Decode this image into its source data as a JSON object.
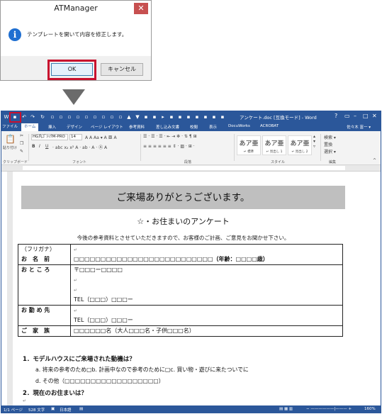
{
  "dialog": {
    "title": "ATManager",
    "close": "✕",
    "message": "テンプレートを開いて内容を修正します。",
    "ok": "OK",
    "cancel": "キャンセル"
  },
  "word": {
    "title": "アンケート.doc [互換モード] - Word",
    "tabs": [
      "ファイル",
      "ホーム",
      "挿入",
      "デザイン",
      "ページ レイアウト",
      "参考資料",
      "差し込み文書",
      "校閲",
      "表示",
      "DocuWorks",
      "ACROBAT"
    ],
    "user": "佐々木 富一 ▾",
    "font_name": "HG丸ｺﾞｼｯｸM-PRO",
    "font_size": "14",
    "paste_label": "貼り付け",
    "groups": [
      "クリップボード",
      "フォント",
      "段落",
      "スタイル",
      "編集"
    ],
    "styles": [
      {
        "sample": "あア亜",
        "name": "↵ 標準"
      },
      {
        "sample": "あア亜",
        "name": "↵ 見出し 1"
      },
      {
        "sample": "あア亜",
        "name": "↵ 見出し 2"
      },
      {
        "sample": "あア亜",
        "name": "↵ 見出し 3"
      }
    ],
    "editing": [
      "検索 ▾",
      "置換",
      "選択 ▾"
    ],
    "status": {
      "page": "1/1 ページ",
      "words": "528 文字",
      "lang": "日本語",
      "zoom": "160%"
    }
  },
  "document": {
    "banner": "ご来場ありがとうございます。",
    "subtitle": "☆・お住まいのアンケート",
    "intro": "今後の参考資料とさせていただきますので、お客様のご計画、ご意見をお聞かせ下さい。",
    "form": {
      "furigana": "（フリガナ）",
      "name_label": "お　名　前",
      "name_value": "□□□□□□□□□□□□□□□□□□□□□□□□□□",
      "age": "（年齢：□□□□歳）",
      "address_label": "お と こ ろ",
      "address_value": "〒□□□ー□□□□",
      "tel": "TEL（□□□）□□□ー",
      "work_label": "お 勤 め 先",
      "work_tel": "TEL（□□□）□□□ー",
      "family_label": "ご　家　族",
      "family_value": "□□□□□□名（大人□□□名・子供□□□名）"
    },
    "q1": "1．モデルハウスにご来場された動機は？",
    "q1_options": "a. 将来の参考のため□b. 計画中なので参考のために□c. 買い物・遊びに来たついでに",
    "q1_other": "d. その他（□□□□□□□□□□□□□□□□□□）",
    "q2": "2．現在のお住まいは？"
  }
}
